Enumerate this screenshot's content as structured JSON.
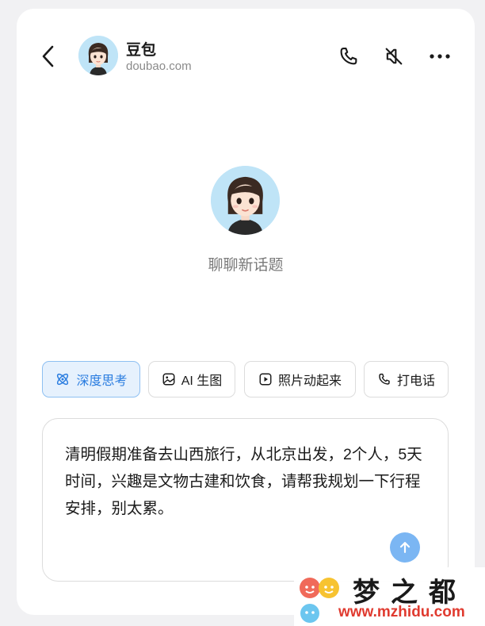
{
  "header": {
    "title": "豆包",
    "subtitle": "doubao.com"
  },
  "center": {
    "new_topic": "聊聊新话题"
  },
  "chips": [
    {
      "label": "深度思考",
      "icon": "atom-icon",
      "active": true
    },
    {
      "label": "AI 生图",
      "icon": "image-icon",
      "active": false
    },
    {
      "label": "照片动起来",
      "icon": "play-icon",
      "active": false
    },
    {
      "label": "打电话",
      "icon": "phone-icon",
      "active": false
    }
  ],
  "input": {
    "value": "清明假期准备去山西旅行，从北京出发，2个人，5天时间，兴趣是文物古建和饮食，请帮我规划一下行程安排，别太累。"
  },
  "watermark": {
    "name": "梦之都",
    "url": "www.mzhidu.com"
  },
  "colors": {
    "accent": "#2b7de0",
    "send_button": "#7bb6f3",
    "chip_active_bg": "#e6f1fd",
    "watermark_url": "#e03a2f"
  }
}
